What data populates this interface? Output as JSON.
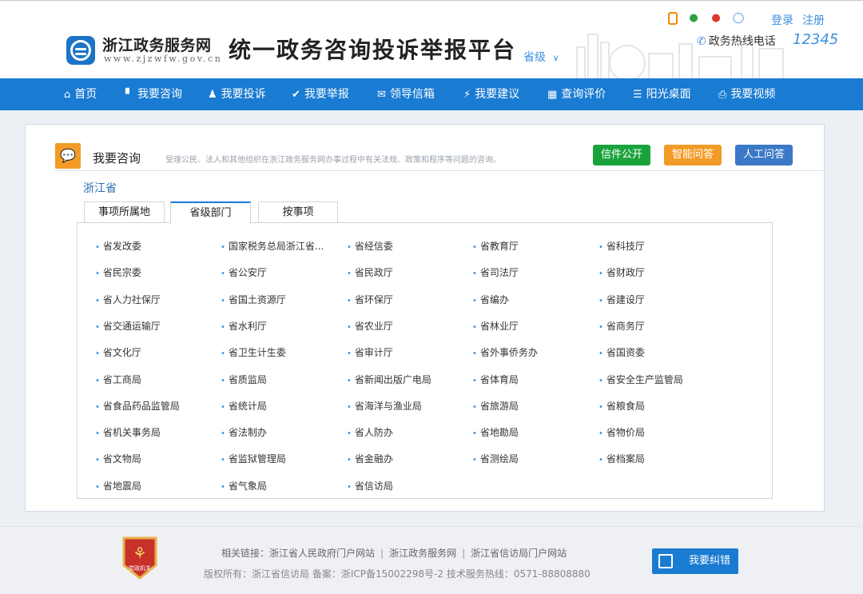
{
  "header": {
    "logo_name": "浙江政务服务网",
    "logo_url": "www.zjzwfw.gov.cn",
    "platform_title": "统一政务咨询投诉举报平台",
    "level_select": "省级",
    "login": "登录",
    "register": "注册",
    "hotline_label": "政务热线电话",
    "hotline_number": "12345"
  },
  "nav": {
    "items": [
      {
        "icon": "home-icon",
        "label": "首页"
      },
      {
        "icon": "document-icon",
        "label": "我要咨询"
      },
      {
        "icon": "user-icon",
        "label": "我要投诉"
      },
      {
        "icon": "check-icon",
        "label": "我要举报"
      },
      {
        "icon": "mail-icon",
        "label": "领导信箱"
      },
      {
        "icon": "wand-icon",
        "label": "我要建议"
      },
      {
        "icon": "grid-icon",
        "label": "查询评价"
      },
      {
        "icon": "menu-icon",
        "label": "阳光桌面"
      },
      {
        "icon": "video-icon",
        "label": "我要视频"
      }
    ]
  },
  "panel": {
    "title": "我要咨询",
    "description": "受理公民、法人和其他组织在浙江政务服务网办事过程中有关法规、政策和程序等问题的咨询。",
    "buttons": {
      "public": "信件公开",
      "smart": "智能问答",
      "manual": "人工问答"
    },
    "province": "浙江省",
    "tabs": [
      "事项所属地",
      "省级部门",
      "按事项"
    ],
    "active_tab": "省级部门",
    "departments": [
      "省发改委",
      "国家税务总局浙江省...",
      "省经信委",
      "省教育厅",
      "省科技厅",
      "省民宗委",
      "省公安厅",
      "省民政厅",
      "省司法厅",
      "省财政厅",
      "省人力社保厅",
      "省国土资源厅",
      "省环保厅",
      "省编办",
      "省建设厅",
      "省交通运输厅",
      "省水利厅",
      "省农业厅",
      "省林业厅",
      "省商务厅",
      "省文化厅",
      "省卫生计生委",
      "省审计厅",
      "省外事侨务办",
      "省国资委",
      "省工商局",
      "省质监局",
      "省新闻出版广电局",
      "省体育局",
      "省安全生产监管局",
      "省食品药品监管局",
      "省统计局",
      "省海洋与渔业局",
      "省旅游局",
      "省粮食局",
      "省机关事务局",
      "省法制办",
      "省人防办",
      "省地勘局",
      "省物价局",
      "省文物局",
      "省监狱管理局",
      "省金融办",
      "省测绘局",
      "省档案局",
      "省地震局",
      "省气象局",
      "省信访局"
    ]
  },
  "footer": {
    "emblem_text": "党政机关",
    "links_prefix": "相关链接：",
    "links": [
      "浙江省人民政府门户网站",
      "浙江政务服务网",
      "浙江省信访局门户网站"
    ],
    "separator": "|",
    "copyright": "版权所有：浙江省信访局   备案：浙ICP备15002298号-2  技术服务热线：0571-88808880",
    "correction_button": "我要纠错"
  },
  "colors": {
    "nav_blue": "#1a7bd2",
    "green": "#1aa33b",
    "orange": "#f39b27",
    "blue_button": "#3b78c7"
  }
}
